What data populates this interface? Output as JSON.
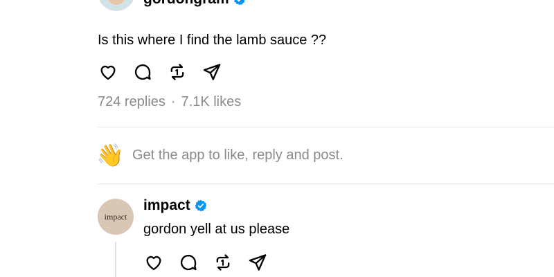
{
  "post": {
    "author": {
      "handle": "gordongram",
      "verified": true
    },
    "text": "Is this where I find the lamb sauce ??",
    "stats": {
      "replies": "724 replies",
      "separator": "·",
      "likes": "7.1K likes"
    }
  },
  "app_prompt": {
    "emoji": "👋",
    "text": "Get the app to like, reply and post."
  },
  "reply": {
    "author": {
      "handle": "impact",
      "avatar_text": "impact",
      "verified": true
    },
    "text": "gordon yell at us please"
  },
  "icons": {
    "actions": [
      "heart-icon",
      "comment-icon",
      "repost-icon",
      "share-icon"
    ],
    "verified": "verified-badge-icon"
  },
  "colors": {
    "verified_blue": "#0095f6",
    "muted_text": "#8a8a8a",
    "divider": "#e5e5e5",
    "impact_avatar_bg": "#d9c7b6"
  }
}
